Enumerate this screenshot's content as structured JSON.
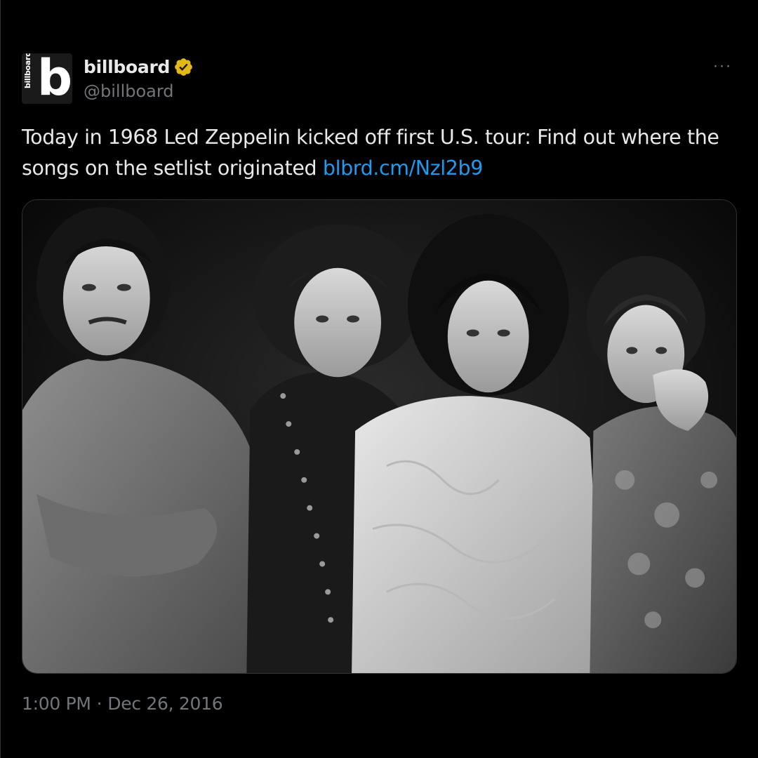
{
  "account": {
    "display_name": "billboard",
    "handle": "@billboard",
    "avatar_letter": "b",
    "avatar_wordmark": "billboard",
    "verified_icon": "verified-badge-icon",
    "verified_color": "#e2b719"
  },
  "more_icon": "more-options-icon",
  "more_glyph": "···",
  "tweet": {
    "text": "Today in 1968 Led Zeppelin kicked off first U.S. tour: Find out where the songs on the setlist originated ",
    "link": "blbrd.cm/Nzl2b9",
    "link_color": "#1d9bf0"
  },
  "media": {
    "kind": "black-and-white group photograph"
  },
  "timestamp": {
    "time": "1:00 PM",
    "separator": "·",
    "date": "Dec 26, 2016"
  }
}
